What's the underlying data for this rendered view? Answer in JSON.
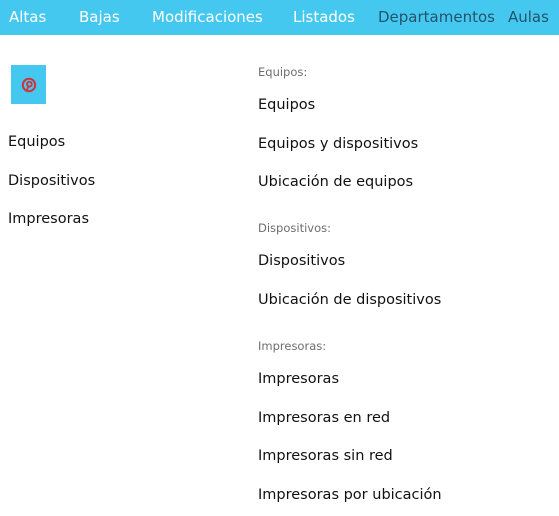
{
  "nav": {
    "items": [
      {
        "label": "Altas"
      },
      {
        "label": "Bajas"
      },
      {
        "label": "Modificaciones"
      },
      {
        "label": "Listados"
      },
      {
        "label": "Departamentos"
      },
      {
        "label": "Aulas"
      }
    ]
  },
  "logo": {
    "icon": "pinterest-icon",
    "bg_color": "#45c8f0",
    "icon_color": "#d0343b"
  },
  "sidebar": {
    "items": [
      {
        "label": "Equipos"
      },
      {
        "label": "Dispositivos"
      },
      {
        "label": "Impresoras"
      }
    ]
  },
  "menu": {
    "groups": [
      {
        "heading": "Equipos:",
        "links": [
          {
            "label": "Equipos"
          },
          {
            "label": "Equipos y dispositivos"
          },
          {
            "label": "Ubicación de equipos"
          }
        ]
      },
      {
        "heading": "Dispositivos:",
        "links": [
          {
            "label": "Dispositivos"
          },
          {
            "label": "Ubicación de dispositivos"
          }
        ]
      },
      {
        "heading": "Impresoras:",
        "links": [
          {
            "label": "Impresoras"
          },
          {
            "label": "Impresoras en red"
          },
          {
            "label": "Impresoras sin red"
          },
          {
            "label": "Impresoras por ubicación"
          }
        ]
      }
    ]
  },
  "colors": {
    "nav_bg": "#45c8f0",
    "nav_text": "#ffffff",
    "nav_text_muted": "#24546a"
  }
}
